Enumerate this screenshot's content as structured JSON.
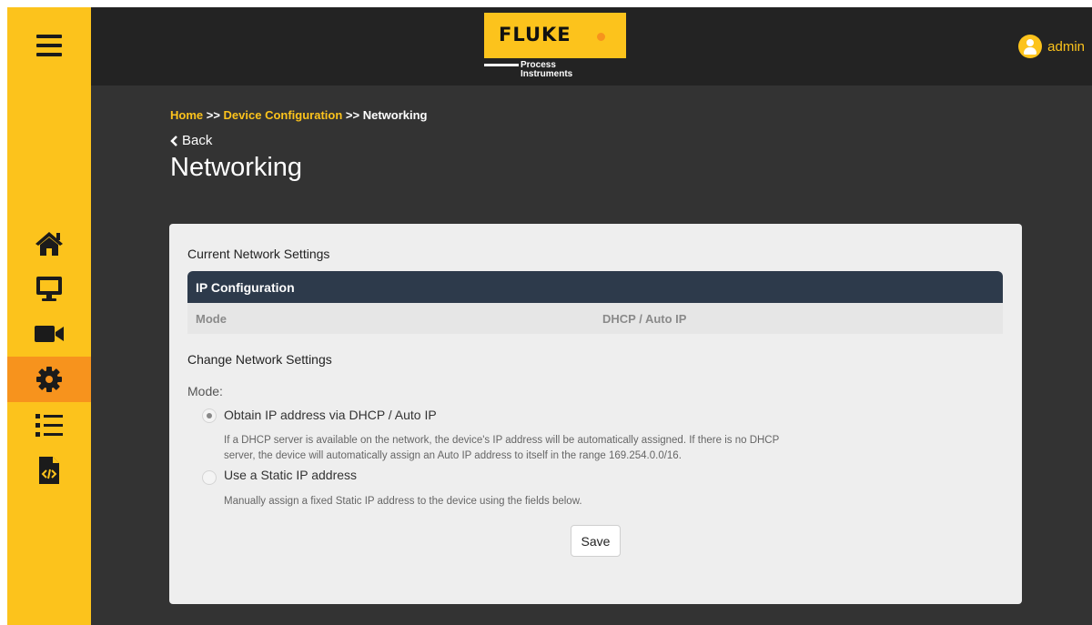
{
  "header": {
    "logo": {
      "brand": "FLUKE",
      "sub_line1": "Process",
      "sub_line2": "Instruments"
    },
    "user": {
      "name": "admin"
    }
  },
  "sidebar": {
    "items": [
      {
        "icon": "home-icon",
        "active": false
      },
      {
        "icon": "monitor-icon",
        "active": false
      },
      {
        "icon": "video-camera-icon",
        "active": false
      },
      {
        "icon": "gear-icon",
        "active": true
      },
      {
        "icon": "list-icon",
        "active": false
      },
      {
        "icon": "code-file-icon",
        "active": false
      }
    ]
  },
  "breadcrumb": {
    "home": "Home",
    "sep1": " >> ",
    "device_config": "Device Configuration",
    "sep2": " >> ",
    "current": "Networking"
  },
  "back_label": "Back",
  "page_title": "Networking",
  "current_settings": {
    "title": "Current Network Settings",
    "table_header": "IP Configuration",
    "row": {
      "label": "Mode",
      "value": "DHCP / Auto IP"
    }
  },
  "change_settings": {
    "title": "Change Network Settings",
    "mode_label": "Mode:",
    "options": [
      {
        "label": "Obtain IP address via DHCP / Auto IP",
        "selected": true,
        "desc_line1": "If a DHCP server is available on the network, the device's IP address will be automatically assigned. If there is no DHCP",
        "desc_line2": "server, the device will automatically assign an Auto IP address to itself in the range 169.254.0.0/16."
      },
      {
        "label": "Use a Static IP address",
        "selected": false,
        "desc_line1": "Manually assign a fixed Static IP address to the device using the fields below."
      }
    ],
    "save_label": "Save"
  },
  "colors": {
    "accent_yellow": "#fcc31c",
    "active_orange": "#f7931d",
    "header_bg": "#232323",
    "main_bg": "#333333",
    "table_head": "#2d3a4b"
  }
}
